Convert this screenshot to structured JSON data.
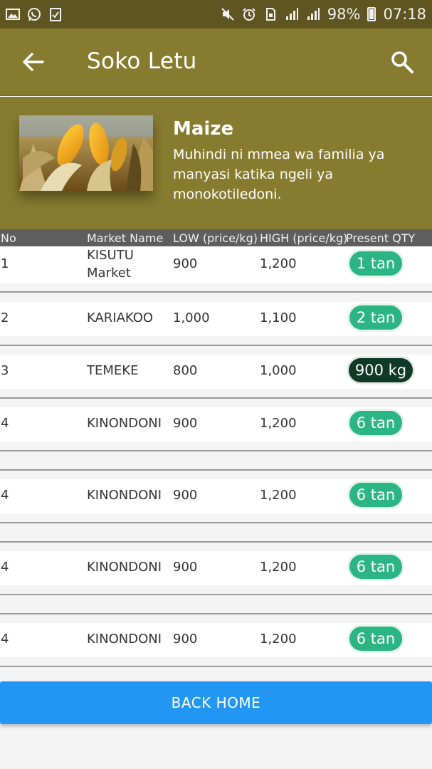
{
  "status_bar": {
    "battery": "98%",
    "time": "07:18",
    "left_icons": [
      "gallery-icon",
      "whatsapp-icon",
      "clipboard-check-icon"
    ],
    "right_icons": [
      "mute-icon",
      "alarm-icon",
      "sim-icon",
      "signal-icon",
      "signal-icon",
      "battery-icon"
    ]
  },
  "toolbar": {
    "title": "Soko Letu"
  },
  "product": {
    "name": "Maize",
    "description": "Muhindi ni mmea wa familia ya manyasi katika ngeli ya monokotiledoni."
  },
  "table": {
    "headers": [
      "No",
      "Market Name",
      "LOW (price/kg)",
      "HIGH (price/kg)",
      "Present QTY"
    ],
    "rows": [
      {
        "no": "1",
        "market": "KISUTU Market",
        "low": "900",
        "high": "1,200",
        "qty": "1 tan",
        "qty_style": "green"
      },
      {
        "no": "2",
        "market": "KARIAKOO",
        "low": "1,000",
        "high": "1,100",
        "qty": "2 tan",
        "qty_style": "green"
      },
      {
        "no": "3",
        "market": "TEMEKE",
        "low": "800",
        "high": "1,000",
        "qty": "900 kg",
        "qty_style": "dark"
      },
      {
        "no": "4",
        "market": "KINONDONI",
        "low": "900",
        "high": "1,200",
        "qty": "6 tan",
        "qty_style": "green"
      },
      {
        "no": "4",
        "market": "KINONDONI",
        "low": "900",
        "high": "1,200",
        "qty": "6 tan",
        "qty_style": "green"
      },
      {
        "no": "4",
        "market": "KINONDONI",
        "low": "900",
        "high": "1,200",
        "qty": "6 tan",
        "qty_style": "green"
      },
      {
        "no": "4",
        "market": "KINONDONI",
        "low": "900",
        "high": "1,200",
        "qty": "6 tan",
        "qty_style": "green"
      }
    ]
  },
  "back_home_label": "BACK HOME",
  "colors": {
    "toolbar": "#867b2e",
    "status_bar": "#5f5520",
    "table_header": "#5e5e5e",
    "qty_green": "#2bb585",
    "qty_dark": "#0f3a2a",
    "button_blue": "#2196f3"
  }
}
